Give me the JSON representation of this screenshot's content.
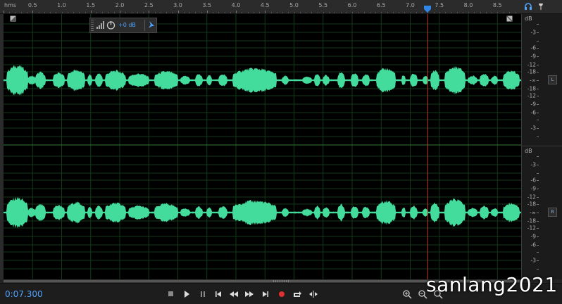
{
  "ruler": {
    "unit": "hms",
    "labels": [
      "0.5",
      "1.0",
      "1.5",
      "2.0",
      "2.5",
      "3.0",
      "3.5",
      "4.0",
      "4.5",
      "5.0",
      "5.5",
      "6.0",
      "6.5",
      "7.0",
      "7.5",
      "8.0",
      "8.5"
    ],
    "playhead_seconds": 7.3,
    "visible_range_seconds": [
      0.0,
      8.85
    ]
  },
  "hud": {
    "volume_label": "+0 dB"
  },
  "db_scale": {
    "unit": "dB",
    "labels": [
      "-3",
      "-6",
      "-9",
      "-12",
      "-18",
      "-∞",
      "-18",
      "-12",
      "-9",
      "-6",
      "-3"
    ]
  },
  "channels": {
    "left": "L",
    "right": "R"
  },
  "transport": {
    "current_time": "0:07.300"
  },
  "watermark": "sanlang2021",
  "colors": {
    "waveform": "#44dc9c",
    "playhead": "#c0392b",
    "grid": "#133a1a",
    "time_text": "#4fa3ff",
    "record": "#e03030"
  },
  "icons": [
    "headphones-icon",
    "pin-icon",
    "zoom-in-icon",
    "zoom-out-icon",
    "stop-icon",
    "play-icon",
    "pause-icon",
    "skip-start-icon",
    "rewind-icon",
    "fast-forward-icon",
    "skip-end-icon",
    "record-icon",
    "loop-icon",
    "skip-selection-icon",
    "fullscreen-icon",
    "power-icon",
    "meter-icon"
  ]
}
